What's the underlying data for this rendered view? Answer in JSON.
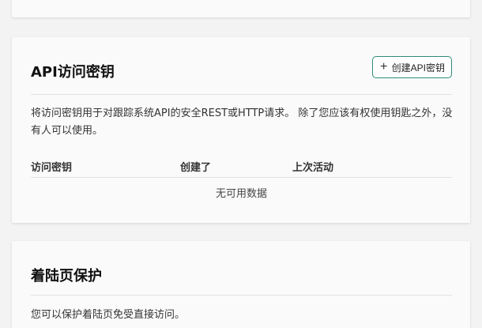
{
  "api_keys": {
    "title": "API访问密钥",
    "create_button_label": "创建API密钥",
    "description": "将访问密钥用于对跟踪系统API的安全REST或HTTP请求。 除了您应该有权使用钥匙之外，没有人可以使用。",
    "columns": [
      "访问密钥",
      "创建了",
      "上次活动"
    ],
    "empty_text": "无可用数据"
  },
  "landing_protection": {
    "title": "着陆页保护",
    "description": "您可以保护着陆页免受直接访问。"
  },
  "accent_color": "#2e8b78",
  "icons": {
    "create": "plus-icon"
  }
}
